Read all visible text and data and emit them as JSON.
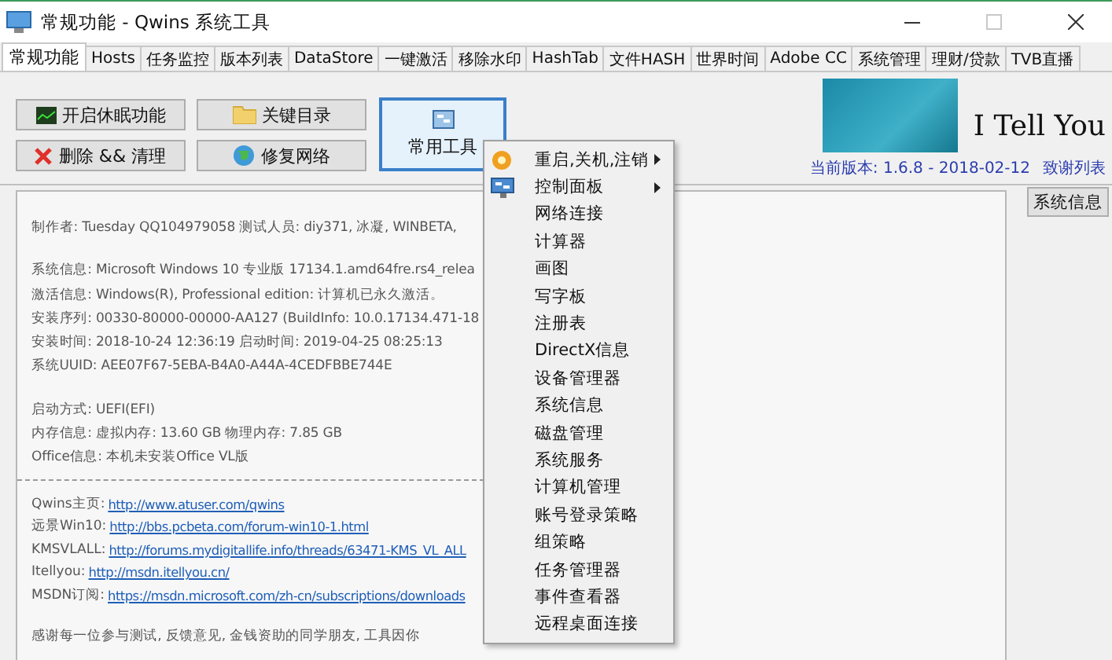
{
  "window": {
    "title": "常规功能 - Qwins 系统工具",
    "maximize_disabled": true
  },
  "tabs": [
    {
      "label": "常规功能",
      "selected": true
    },
    {
      "label": "Hosts",
      "selected": false
    },
    {
      "label": "任务监控",
      "selected": false
    },
    {
      "label": "版本列表",
      "selected": false
    },
    {
      "label": "DataStore",
      "selected": false
    },
    {
      "label": "一键激活",
      "selected": false
    },
    {
      "label": "移除水印",
      "selected": false
    },
    {
      "label": "HashTab",
      "selected": false
    },
    {
      "label": "文件HASH",
      "selected": false
    },
    {
      "label": "世界时间",
      "selected": false
    },
    {
      "label": "Adobe CC",
      "selected": false
    },
    {
      "label": "系统管理",
      "selected": false
    },
    {
      "label": "理财/贷款",
      "selected": false
    },
    {
      "label": "TVB直播",
      "selected": false
    }
  ],
  "buttons": [
    {
      "label": "开启休眠功能"
    },
    {
      "label": "关键目录"
    },
    {
      "label": "删除 && 清理"
    },
    {
      "label": "修复网络"
    }
  ],
  "tools_button": {
    "label": "常用工具",
    "pressed": true
  },
  "header": {
    "brand": "I Tell You",
    "version": "当前版本: 1.6.8 - 2018-02-12",
    "credits_link": "致谢列表"
  },
  "sysinfo_button": "系统信息",
  "panel": {
    "lines": [
      {
        "kind": "text",
        "text": "制作者: Tuesday QQ104979058 测试人员: diy371, 冰凝, WINBETA,"
      },
      {
        "kind": "gap"
      },
      {
        "kind": "text",
        "text": "系统信息: Microsoft Windows 10 专业版 17134.1.amd64fre.rs4_relea"
      },
      {
        "kind": "text",
        "text": "激活信息: Windows(R), Professional edition:  计算机已永久激活。"
      },
      {
        "kind": "text",
        "text": "安装序列: 00330-80000-00000-AA127 (BuildInfo: 10.0.17134.471-18"
      },
      {
        "kind": "text",
        "text": "安装时间: 2018-10-24 12:36:19 启动时间: 2019-04-25 08:25:13"
      },
      {
        "kind": "text",
        "text": "系统UUID: AEE07F67-5EBA-B4A0-A44A-4CEDFBBE744E"
      },
      {
        "kind": "gap"
      },
      {
        "kind": "text",
        "text": "启动方式: UEFI(EFI)"
      },
      {
        "kind": "text",
        "text": "内存信息: 虚拟内存: 13.60 GB 物理内存: 7.85 GB"
      },
      {
        "kind": "text",
        "text": "Office信息: 本机未安装Office VL版"
      },
      {
        "kind": "rule"
      },
      {
        "kind": "link",
        "text": "Qwins主页:",
        "url": "http://www.atuser.com/qwins"
      },
      {
        "kind": "link",
        "text": "远景Win10:",
        "url": "http://bbs.pcbeta.com/forum-win10-1.html"
      },
      {
        "kind": "link",
        "text": "KMSVLALL:",
        "url": "http://forums.mydigitallife.info/threads/63471-KMS_VL_ALL"
      },
      {
        "kind": "link",
        "text": "Itellyou:",
        "url": "http://msdn.itellyou.cn/"
      },
      {
        "kind": "link",
        "text": "MSDN订阅:",
        "url": "https://msdn.microsoft.com/zh-cn/subscriptions/downloads"
      },
      {
        "kind": "gap"
      },
      {
        "kind": "text",
        "text": "感谢每一位参与测试, 反馈意见, 金钱资助的同学朋友, 工具因你"
      }
    ]
  },
  "menu": {
    "items": [
      {
        "label": "重启,关机,注销",
        "has_submenu": true
      },
      {
        "label": "控制面板",
        "has_submenu": true
      },
      {
        "label": "网络连接",
        "has_submenu": false
      },
      {
        "label": "计算器",
        "has_submenu": false
      },
      {
        "label": "画图",
        "has_submenu": false
      },
      {
        "label": "写字板",
        "has_submenu": false
      },
      {
        "label": "注册表",
        "has_submenu": false
      },
      {
        "label": "DirectX信息",
        "has_submenu": false
      },
      {
        "label": "设备管理器",
        "has_submenu": false
      },
      {
        "label": "系统信息",
        "has_submenu": false
      },
      {
        "label": "磁盘管理",
        "has_submenu": false
      },
      {
        "label": "系统服务",
        "has_submenu": false
      },
      {
        "label": "计算机管理",
        "has_submenu": false
      },
      {
        "label": "账号登录策略",
        "has_submenu": false
      },
      {
        "label": "组策略",
        "has_submenu": false
      },
      {
        "label": "任务管理器",
        "has_submenu": false
      },
      {
        "label": "事件查看器",
        "has_submenu": false
      },
      {
        "label": "远程桌面连接",
        "has_submenu": false
      }
    ]
  }
}
